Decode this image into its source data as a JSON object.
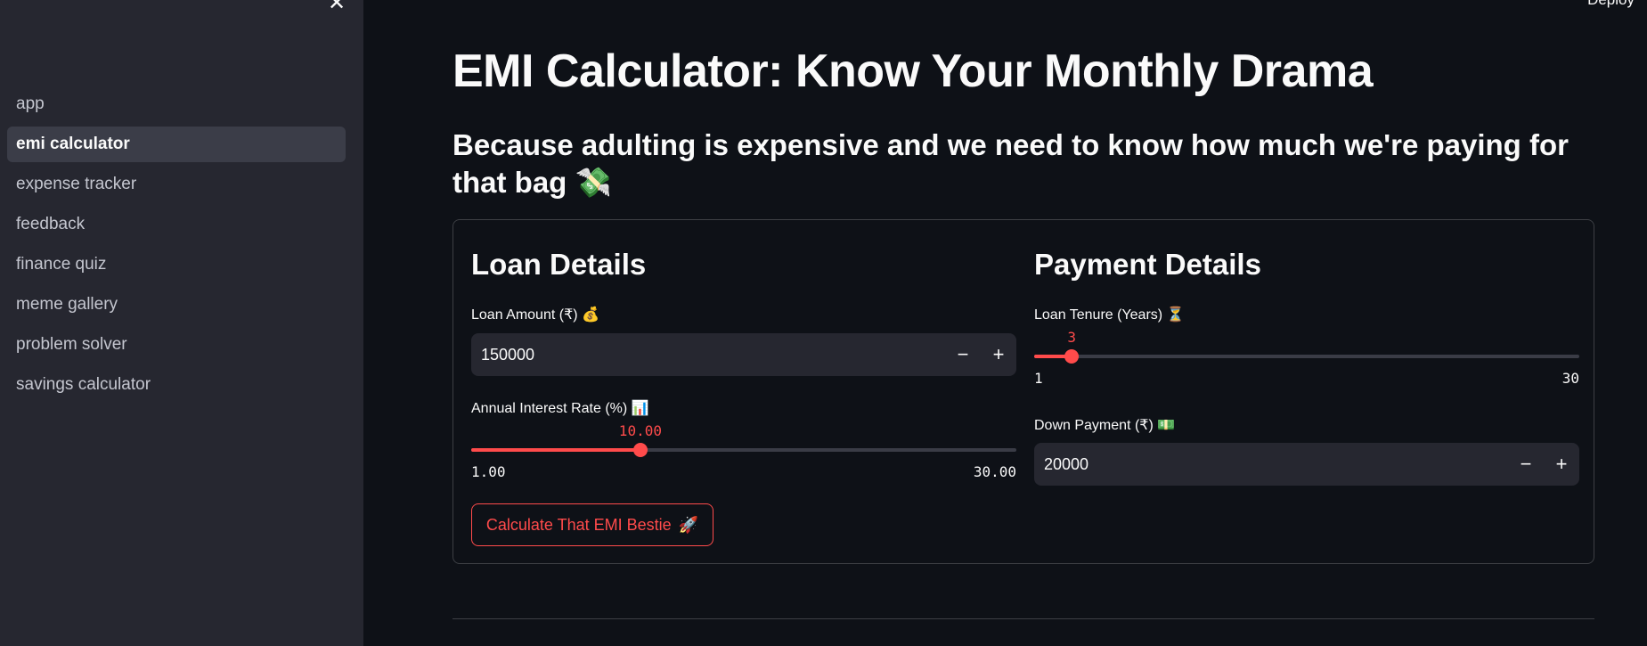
{
  "sidebar": {
    "close_glyph": "✕",
    "items": [
      {
        "label": "app",
        "active": false
      },
      {
        "label": "emi calculator",
        "active": true
      },
      {
        "label": "expense tracker",
        "active": false
      },
      {
        "label": "feedback",
        "active": false
      },
      {
        "label": "finance quiz",
        "active": false
      },
      {
        "label": "meme gallery",
        "active": false
      },
      {
        "label": "problem solver",
        "active": false
      },
      {
        "label": "savings calculator",
        "active": false
      }
    ]
  },
  "header": {
    "deploy_label": "Deploy"
  },
  "main": {
    "title": "EMI Calculator: Know Your Monthly Drama",
    "subtitle": "Because adulting is expensive and we need to know how much we're paying for that bag",
    "subtitle_emoji": "💸",
    "loan_details": {
      "heading": "Loan Details",
      "loan_amount": {
        "label": "Loan Amount (₹)",
        "emoji": "💰",
        "value": "150000",
        "minus": "−",
        "plus": "+"
      },
      "interest_rate": {
        "label": "Annual Interest Rate (%)",
        "emoji": "📊",
        "value": "10.00",
        "min": "1.00",
        "max": "30.00",
        "fraction": 0.3103
      },
      "calculate_button": {
        "label": "Calculate That EMI Bestie",
        "emoji": "🚀"
      }
    },
    "payment_details": {
      "heading": "Payment Details",
      "loan_tenure": {
        "label": "Loan Tenure (Years)",
        "emoji": "⏳",
        "value": "3",
        "min": "1",
        "max": "30",
        "fraction": 0.069
      },
      "down_payment": {
        "label": "Down Payment (₹)",
        "emoji": "💵",
        "value": "20000",
        "minus": "−",
        "plus": "+"
      }
    }
  },
  "colors": {
    "accent": "#ff4b4b",
    "background": "#0e1117",
    "sidebar": "#262730"
  }
}
